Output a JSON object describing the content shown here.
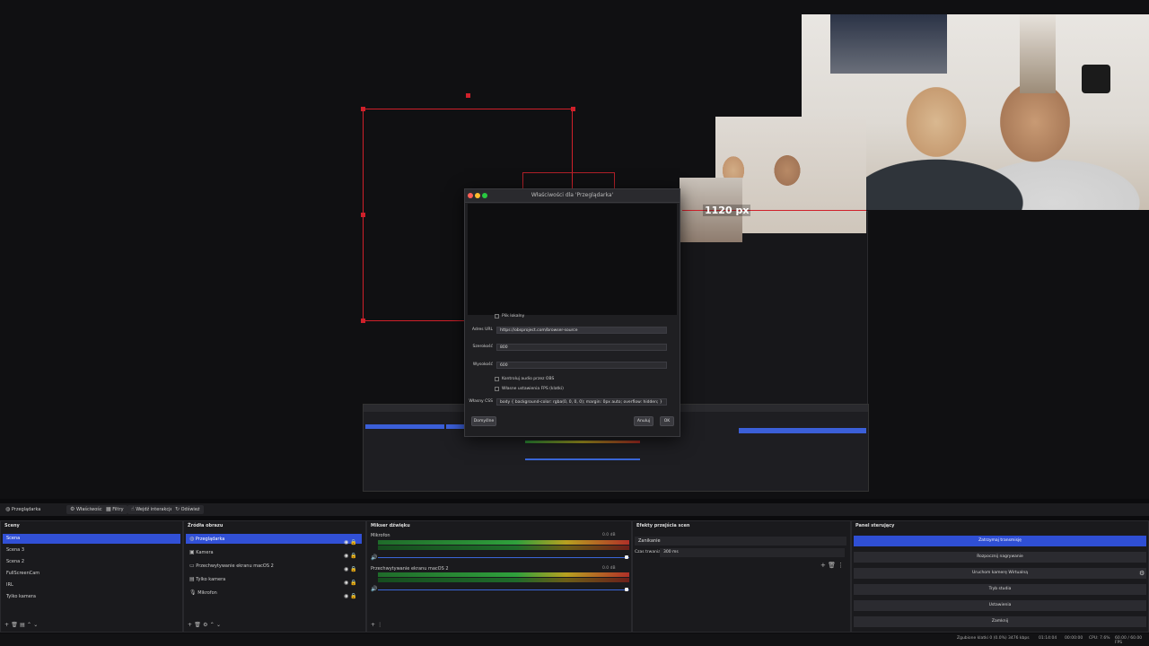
{
  "preview": {
    "measure_label": "1120 px",
    "nested_obs_caption": "Właściwości"
  },
  "dialog": {
    "title": "Właściwości dla 'Przeglądarka'",
    "local_file_label": "Plik lokalny",
    "url_label": "Adres URL",
    "url_value": "https://obsproject.com/browser-source",
    "width_label": "Szerokość",
    "width_value": "800",
    "height_label": "Wysokość",
    "height_value": "600",
    "audio_check_label": "Kontroluj audio przez OBS",
    "fps_check_label": "Własne ustawienia FPS (klatki)",
    "css_label": "Własny CSS",
    "css_value": "body { background-color: rgba(0, 0, 0, 0); margin: 0px auto; overflow: hidden; }",
    "defaults_button": "Domyślne",
    "cancel_button": "Anuluj",
    "ok_button": "OK"
  },
  "toolbar": {
    "source_name": "Przeglądarka",
    "properties": "Właściwości",
    "filters": "Filtry",
    "interact": "Wejdź interakcję",
    "refresh": "Odśwież"
  },
  "scenes": {
    "title": "Sceny",
    "items": [
      "Scena",
      "Scena 3",
      "Scena 2",
      "FullScreenCam",
      "IRL",
      "Tylko kamera"
    ]
  },
  "sources": {
    "title": "Źródła obrazu",
    "items": [
      "Przeglądarka",
      "Kamera",
      "Przechwytywanie ekranu macOS 2",
      "Tylko kamera",
      "Mikrofon"
    ]
  },
  "mixer": {
    "title": "Mikser dźwięku",
    "channels": [
      {
        "name": "Mikrofon",
        "db": "0.0 dB"
      },
      {
        "name": "Przechwytywanie ekranu macOS 2",
        "db": "0.0 dB"
      }
    ]
  },
  "transitions": {
    "title": "Efekty przejścia scen",
    "selected": "Zanikanie",
    "duration_label": "Czas trwania",
    "duration_value": "300 ms"
  },
  "controls": {
    "title": "Panel sterujący",
    "buttons": [
      "Zatrzymaj transmisję",
      "Rozpocznij nagrywanie",
      "Uruchom kamerę Wirtualną",
      "Tryb studia",
      "Ustawienia",
      "Zamknij"
    ]
  },
  "statusbar": {
    "dropped": "Zgubione klatki 0 (0.0%)",
    "bitrate": "3476 kbps",
    "stream_time": "01:14:04",
    "rec_time": "00:00:00",
    "cpu": "CPU: 7.6%",
    "fps": "60.00 / 60.00 FPS"
  }
}
